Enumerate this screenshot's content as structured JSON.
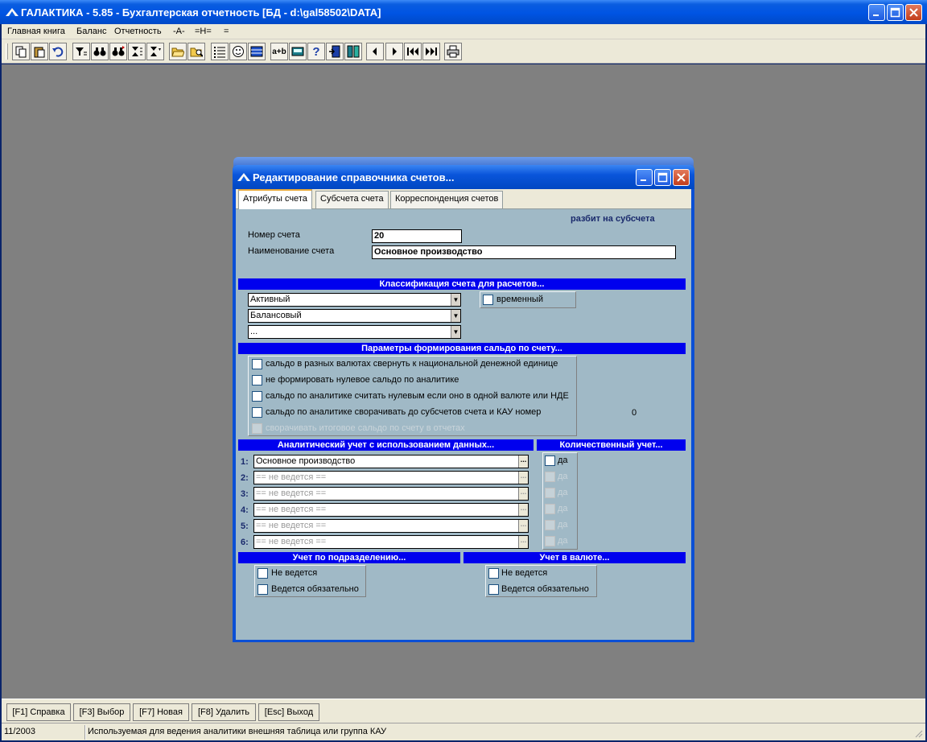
{
  "app": {
    "title": "ГАЛАКТИКА - 5.85 - Бухгалтерская отчетность [БД - d:\\gal58502\\DATA]"
  },
  "menu": [
    {
      "label": "Главная книга"
    },
    {
      "label": "Баланс"
    },
    {
      "label": "Отчетность"
    },
    {
      "label": "-A-"
    },
    {
      "label": "=H="
    },
    {
      "label": "="
    }
  ],
  "toolbar": {
    "text_buttons": {
      "aplusb": "a+b",
      "help": "?"
    }
  },
  "dialog": {
    "title": "Редактирование справочника счетов...",
    "tabs": [
      {
        "label": "Атрибуты счета"
      },
      {
        "label": "Субсчета счета"
      },
      {
        "label": "Корреспонденция счетов"
      }
    ],
    "subaccount_note": "разбит на субсчета",
    "account_number_label": "Номер счета",
    "account_number_value": "20",
    "account_name_label": "Наименование счета",
    "account_name_value": "Основное производство",
    "classification_header": "Классификация счета для расчетов...",
    "classification_selects": [
      "Активный",
      "Балансовый",
      "..."
    ],
    "temporary_label": "временный",
    "saldo_header": "Параметры формирования сальдо по счету...",
    "saldo_options": [
      {
        "label": "сальдо в разных валютах свернуть к национальной денежной единице",
        "enabled": true
      },
      {
        "label": "не формировать нулевое сальдо по аналитике",
        "enabled": true
      },
      {
        "label": "сальдо по аналитике считать нулевым если оно в одной валюте или НДЕ",
        "enabled": true
      },
      {
        "label": "сальдо по аналитике сворачивать до субсчетов счета и КАУ номер",
        "enabled": true
      },
      {
        "label": "сворачивать итоговое сальдо по счету в отчетах",
        "enabled": false
      }
    ],
    "kau_number": "0",
    "analytics_header": "Аналитический учет с использованием данных...",
    "quantity_header": "Количественный учет...",
    "analytics_rows": [
      {
        "num": "1:",
        "value": "Основное производство",
        "qty_label": "да",
        "active": true
      },
      {
        "num": "2:",
        "value": "== не ведется ==",
        "qty_label": "да",
        "active": false
      },
      {
        "num": "3:",
        "value": "== не ведется ==",
        "qty_label": "да",
        "active": false
      },
      {
        "num": "4:",
        "value": "== не ведется ==",
        "qty_label": "да",
        "active": false
      },
      {
        "num": "5:",
        "value": "== не ведется ==",
        "qty_label": "да",
        "active": false
      },
      {
        "num": "6:",
        "value": "== не ведется ==",
        "qty_label": "да",
        "active": false
      }
    ],
    "division_header": "Учет по подразделению...",
    "division_options": [
      "Не ведется",
      "Ведется обязательно"
    ],
    "currency_header": "Учет в валюте...",
    "currency_options": [
      "Не ведется",
      "Ведется обязательно"
    ]
  },
  "fkeys": [
    {
      "label": "[F1] Справка"
    },
    {
      "label": "[F3] Выбор"
    },
    {
      "label": "[F7] Новая"
    },
    {
      "label": "[F8] Удалить"
    },
    {
      "label": "[Esc] Выход"
    }
  ],
  "status": {
    "period": "11/2003",
    "message": "Используемая для ведения аналитики внешняя таблица или группа КАУ"
  },
  "colors": {
    "xp_blue": "#0054e3",
    "band_blue": "#0000ee",
    "dialog_bg": "#a0b9c6",
    "workspace_gray": "#808080"
  }
}
